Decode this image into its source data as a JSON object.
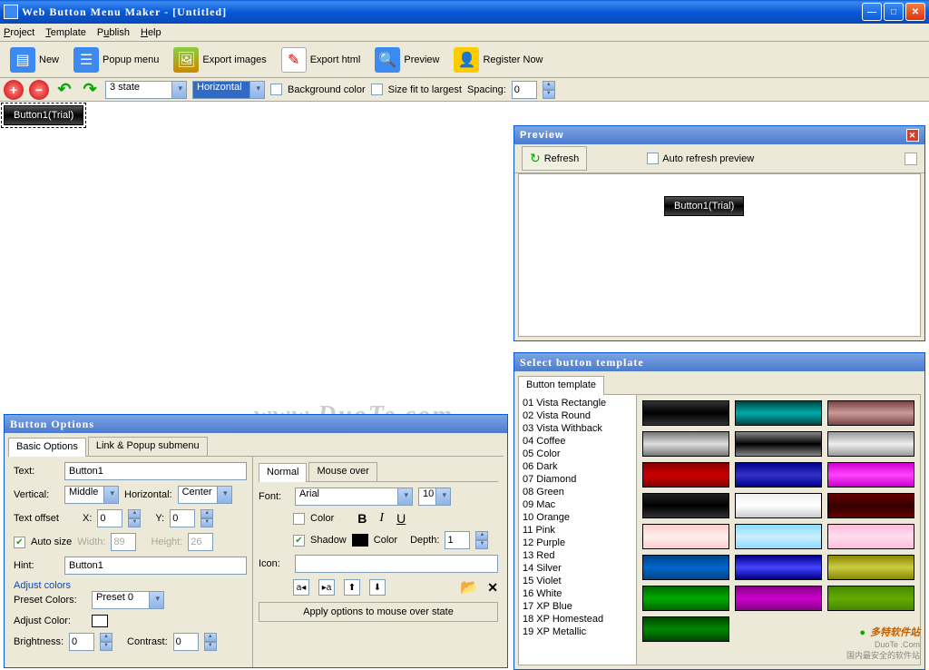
{
  "window": {
    "title": "Web Button Menu Maker - [Untitled]"
  },
  "menu": {
    "project": "Project",
    "template": "Template",
    "publish": "Publish",
    "help": "Help"
  },
  "toolbar": {
    "new": "New",
    "popup": "Popup menu",
    "export_img": "Export images",
    "export_html": "Export html",
    "preview": "Preview",
    "register": "Register Now"
  },
  "toolbar2": {
    "state_sel": "3 state",
    "orientation": "Horizontal",
    "bg_color": "Background color",
    "size_fit": "Size fit to largest",
    "spacing_lbl": "Spacing:",
    "spacing_val": "0"
  },
  "canvas": {
    "button_label": "Button1(Trial)"
  },
  "watermark": "www.DuoTe.com",
  "preview": {
    "title": "Preview",
    "refresh": "Refresh",
    "auto_refresh": "Auto refresh preview",
    "button_label": "Button1(Trial)"
  },
  "templates": {
    "title": "Select button template",
    "tab": "Button template",
    "list": [
      "01 Vista Rectangle",
      "02 Vista Round",
      "03 Vista Withback",
      "04 Coffee",
      "05 Color",
      "06 Dark",
      "07 Diamond",
      "08 Green",
      "09 Mac",
      "10 Orange",
      "11 Pink",
      "12 Purple",
      "13 Red",
      "14 Silver",
      "15 Violet",
      "16 White",
      "17 XP Blue",
      "18 XP Homestead",
      "19 XP Metallic"
    ],
    "colors": [
      "linear-gradient(#333,#000,#333)",
      "linear-gradient(#044,#0aa,#044)",
      "linear-gradient(#744,#c99,#744)",
      "linear-gradient(#777,#ddd,#777)",
      "linear-gradient(#888,#000,#888)",
      "linear-gradient(#999,#eee,#999)",
      "linear-gradient(#800,#c00,#800)",
      "linear-gradient(#008,#33c,#008)",
      "linear-gradient(#c0c,#f4f,#c0c)",
      "linear-gradient(#222,#000,#333)",
      "linear-gradient(#eee,#fff,#ccc)",
      "linear-gradient(#600,#300,#600)",
      "linear-gradient(#fcc,#fee,#fcc)",
      "linear-gradient(#8df,#cef,#8df)",
      "linear-gradient(#fbd,#fde,#fbd)",
      "linear-gradient(#048,#06c,#048)",
      "linear-gradient(#008,#44f,#008)",
      "linear-gradient(#880,#cc4,#880)",
      "linear-gradient(#060,#0a0,#060)",
      "linear-gradient(#808,#c0c,#808)",
      "linear-gradient(#480,#6a0,#480)",
      "linear-gradient(#040,#080,#040)"
    ]
  },
  "options": {
    "title": "Button Options",
    "tab1": "Basic Options",
    "tab2": "Link & Popup submenu",
    "text_lbl": "Text:",
    "text_val": "Button1",
    "vertical_lbl": "Vertical:",
    "vertical_val": "Middle",
    "horizontal_lbl": "Horizontal:",
    "horizontal_val": "Center",
    "offset_lbl": "Text offset",
    "x_lbl": "X:",
    "x_val": "0",
    "y_lbl": "Y:",
    "y_val": "0",
    "autosize_lbl": "Auto size",
    "width_lbl": "Width:",
    "width_val": "89",
    "height_lbl": "Height:",
    "height_val": "26",
    "hint_lbl": "Hint:",
    "hint_val": "Button1",
    "adjust_title": "Adjust colors",
    "preset_lbl": "Preset Colors:",
    "preset_val": "Preset  0",
    "adjust_color_lbl": "Adjust Color:",
    "brightness_lbl": "Brightness:",
    "brightness_val": "0",
    "contrast_lbl": "Contrast:",
    "contrast_val": "0",
    "tab_normal": "Normal",
    "tab_mouseover": "Mouse over",
    "font_lbl": "Font:",
    "font_val": "Arial",
    "font_size": "10",
    "color_lbl": "Color",
    "shadow_lbl": "Shadow",
    "shadow_color": "Color",
    "depth_lbl": "Depth:",
    "depth_val": "1",
    "icon_lbl": "Icon:",
    "apply_btn": "Apply options to mouse over state"
  },
  "duote": {
    "brand1": "多特软件站",
    "brand2": "DuoTe .Com",
    "brand3": "国内最安全的软件站"
  }
}
